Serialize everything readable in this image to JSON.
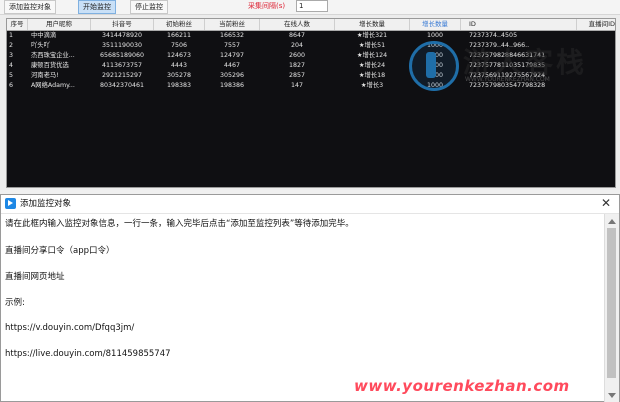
{
  "toolbar": {
    "add_target_label": "添加监控对象",
    "start_label": "开始监控",
    "stop_label": "停止监控",
    "interval_label": "采集间隔(s)",
    "interval_value": "1"
  },
  "table": {
    "headers": [
      "序号",
      "用户昵称",
      "抖音号",
      "初始粉丝",
      "当前粉丝",
      "在线人数",
      "增长数量",
      "增长数量",
      "ID",
      "直播间ID"
    ],
    "rows": [
      {
        "idx": "1",
        "nick": "中中滴滴",
        "dy": "3414478920",
        "init": "166211",
        "cur": "166532",
        "online": "8647",
        "growth": "★增长321",
        "target": "1000",
        "id": "7237374..4505",
        "room": ""
      },
      {
        "idx": "2",
        "nick": "吖头吖",
        "dy": "3511190030",
        "init": "7506",
        "cur": "7557",
        "online": "204",
        "growth": "★增长51",
        "target": "1000",
        "id": "7237379..44..966..",
        "room": ""
      },
      {
        "idx": "3",
        "nick": "杰西珠宝企业...",
        "dy": "65685189060",
        "init": "124673",
        "cur": "124797",
        "online": "2600",
        "growth": "★增长124",
        "target": "1000",
        "id": "7237579828846631741",
        "room": ""
      },
      {
        "idx": "4",
        "nick": "康顿百货优选",
        "dy": "4113673757",
        "init": "4443",
        "cur": "4467",
        "online": "1827",
        "growth": "★增长24",
        "target": "1000",
        "id": "7237577811035179835",
        "room": ""
      },
      {
        "idx": "5",
        "nick": "河南老马!",
        "dy": "2921215297",
        "init": "305278",
        "cur": "305296",
        "online": "2857",
        "growth": "★增长18",
        "target": "1000",
        "id": "7237569119275567924",
        "room": ""
      },
      {
        "idx": "6",
        "nick": "A网络Adamy...",
        "dy": "80342370461",
        "init": "198383",
        "cur": "198386",
        "online": "147",
        "growth": "★增长3",
        "target": "1000",
        "id": "7237579803547798328",
        "room": ""
      }
    ]
  },
  "watermark": {
    "brand": "游人客栈",
    "site": "WWW.YOURENKEZHAN.COM",
    "url": "www.yourenkezhan.com"
  },
  "dialog": {
    "title": "添加监控对象",
    "close": "✕",
    "lines": [
      "请在此框内输入监控对象信息，一行一条，输入完毕后点击“添加至监控列表”等待添加完毕。",
      "直播间分享口令（app口令）",
      "直播间网页地址",
      "示例:",
      "https://v.douyin.com/Dfqq3jm/",
      "https://live.douyin.com/811459855747"
    ]
  }
}
